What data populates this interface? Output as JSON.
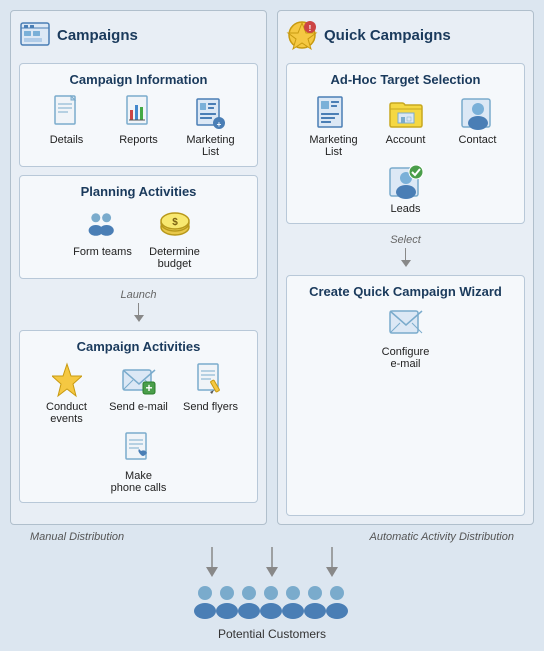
{
  "campaigns": {
    "title": "Campaigns",
    "sections": {
      "campaign_information": {
        "title": "Campaign Information",
        "items": [
          {
            "label": "Details",
            "icon": "document"
          },
          {
            "label": "Reports",
            "icon": "chart"
          },
          {
            "label": "Marketing List",
            "icon": "list"
          }
        ]
      },
      "planning_activities": {
        "title": "Planning Activities",
        "items": [
          {
            "label": "Form teams",
            "icon": "team"
          },
          {
            "label": "Determine budget",
            "icon": "budget"
          }
        ],
        "arrow_label": "Launch"
      },
      "campaign_activities": {
        "title": "Campaign Activities",
        "items": [
          {
            "label": "Conduct events",
            "icon": "lightning"
          },
          {
            "label": "Send e-mail",
            "icon": "email"
          },
          {
            "label": "Send flyers",
            "icon": "flyers"
          },
          {
            "label": "Make phone calls",
            "icon": "phone"
          }
        ]
      }
    }
  },
  "quick_campaigns": {
    "title": "Quick Campaigns",
    "sections": {
      "adhoc": {
        "title": "Ad-Hoc Target Selection",
        "items": [
          {
            "label": "Marketing List",
            "icon": "mktlist"
          },
          {
            "label": "Account",
            "icon": "account"
          },
          {
            "label": "Contact",
            "icon": "contact"
          },
          {
            "label": "Leads",
            "icon": "leads"
          }
        ],
        "arrow_label": "Select"
      },
      "wizard": {
        "title": "Create Quick Campaign Wizard",
        "items": [
          {
            "label": "Configure e-mail",
            "icon": "configure"
          }
        ]
      }
    }
  },
  "bottom": {
    "manual_label": "Manual Distribution",
    "automatic_label": "Automatic Activity Distribution",
    "customers_label": "Potential Customers"
  }
}
